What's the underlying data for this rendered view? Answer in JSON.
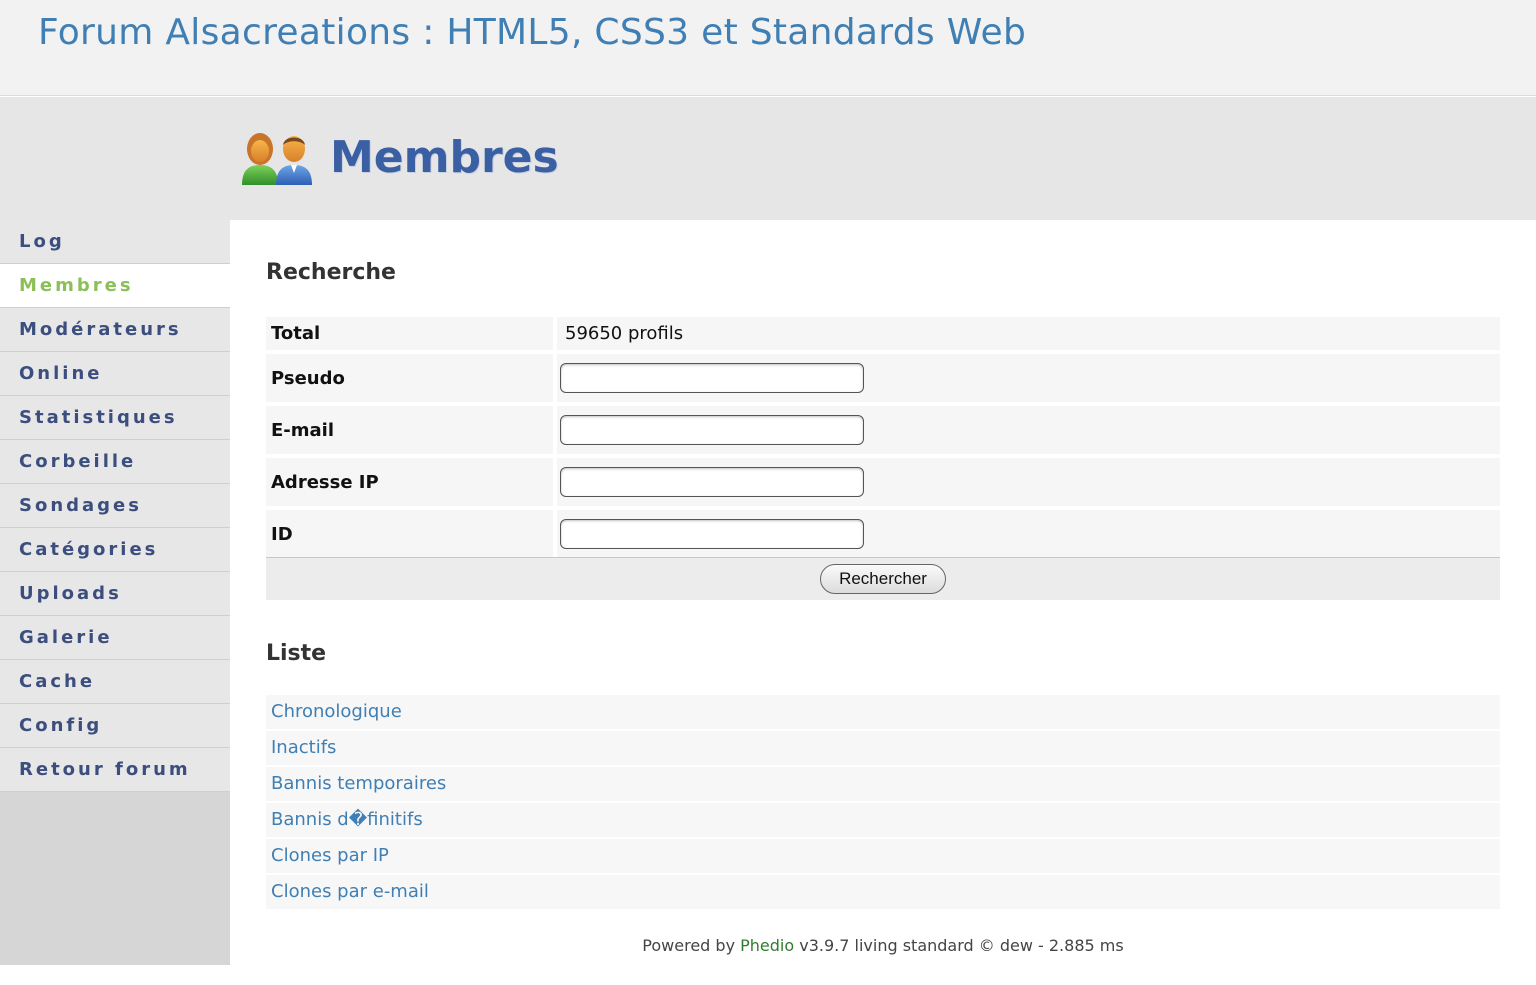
{
  "site": {
    "title": "Forum Alsacreations : HTML5, CSS3 et Standards Web"
  },
  "banner": {
    "title": "Membres",
    "icon": "members-icon"
  },
  "sidebar": {
    "items": [
      {
        "label": "Log"
      },
      {
        "label": "Membres",
        "active": true
      },
      {
        "label": "Modérateurs"
      },
      {
        "label": "Online"
      },
      {
        "label": "Statistiques"
      },
      {
        "label": "Corbeille"
      },
      {
        "label": "Sondages"
      },
      {
        "label": "Catégories"
      },
      {
        "label": "Uploads"
      },
      {
        "label": "Galerie"
      },
      {
        "label": "Cache"
      },
      {
        "label": "Config"
      },
      {
        "label": "Retour forum"
      }
    ]
  },
  "search": {
    "title": "Recherche",
    "total_label": "Total",
    "total_value": "59650 profils",
    "pseudo_label": "Pseudo",
    "email_label": "E-mail",
    "ip_label": "Adresse IP",
    "id_label": "ID",
    "pseudo_value": "",
    "email_value": "",
    "ip_value": "",
    "id_value": "",
    "submit_label": "Rechercher"
  },
  "list": {
    "title": "Liste",
    "items": [
      "Chronologique",
      "Inactifs",
      "Bannis temporaires",
      "Bannis d�finitifs",
      "Clones par IP",
      "Clones par e-mail"
    ]
  },
  "footer": {
    "prefix": "Powered by",
    "brand": "Phedio",
    "suffix": "v3.9.7 living standard © dew - 2.885 ms"
  },
  "colors": {
    "link": "#3f7fb4",
    "nav_text": "#3b4e7e",
    "nav_active": "#8bbf57",
    "footer_brand": "#2f7d2f"
  }
}
